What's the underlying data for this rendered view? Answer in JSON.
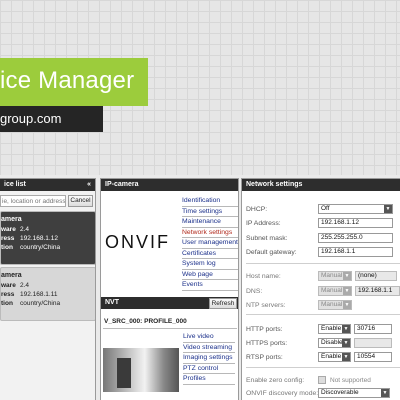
{
  "banner": {
    "title": "ice Manager",
    "subtitle": "group.com"
  },
  "device_list": {
    "title": "ice list",
    "collapse_glyph": "«",
    "search_placeholder": "ie, location or address",
    "cancel_label": "Cancel",
    "devices": [
      {
        "name": "amera",
        "fw_key": "ware",
        "fw": "2.4",
        "addr_key": "ress",
        "addr": "192.168.1.12",
        "loc_key": "tion",
        "loc": "country/China"
      },
      {
        "name": "amera",
        "fw_key": "ware",
        "fw": "2.4",
        "addr_key": "ress",
        "addr": "192.168.1.11",
        "loc_key": "tion",
        "loc": "country/China"
      }
    ]
  },
  "camera": {
    "title": "IP-camera",
    "logo_text": "ONVIF",
    "menu": [
      "Identification",
      "Time settings",
      "Maintenance",
      "Network settings",
      "User management",
      "Certificates",
      "System log",
      "Web page",
      "Events"
    ],
    "nvt_title": "NVT",
    "refresh_label": "Refresh",
    "source_label": "V_SRC_000: PROFILE_000",
    "sub_menu": [
      "Live video",
      "Video streaming",
      "Imaging settings",
      "PTZ control",
      "Profiles"
    ]
  },
  "network": {
    "title": "Network settings",
    "dhcp_label": "DHCP:",
    "dhcp_value": "Off",
    "ip_label": "IP Address:",
    "ip_value": "192.168.1.12",
    "mask_label": "Subnet mask:",
    "mask_value": "255.255.255.0",
    "gw_label": "Default gateway:",
    "gw_value": "192.168.1.1",
    "host_label": "Host name:",
    "host_mode": "Manual",
    "host_value": "(none)",
    "dns_label": "DNS:",
    "dns_mode": "Manual",
    "dns_value": "192.168.1.1",
    "ntp_label": "NTP servers:",
    "ntp_mode": "Manual",
    "http_label": "HTTP ports:",
    "http_mode": "Enable",
    "http_value": "30716",
    "https_label": "HTTPS ports:",
    "https_mode": "Disable",
    "rtsp_label": "RTSP ports:",
    "rtsp_mode": "Enable",
    "rtsp_value": "10554",
    "zero_label": "Enable zero config:",
    "zero_value": "Not supported",
    "disc_label": "ONVIF discovery mode:",
    "disc_value": "Discoverable"
  }
}
